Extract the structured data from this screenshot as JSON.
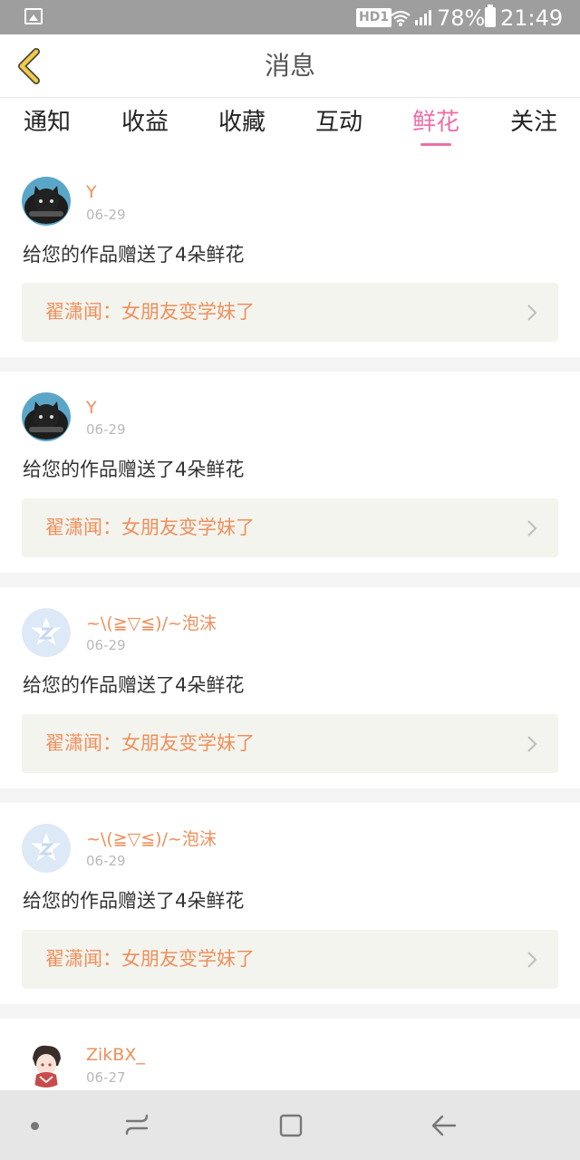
{
  "status_bar": {
    "network_badge": "HD1",
    "battery_percent": "78%",
    "time": "21:49",
    "icons": [
      "image-icon",
      "wifi-icon",
      "signal-icon",
      "battery-icon"
    ]
  },
  "header": {
    "title": "消息",
    "back_icon": "chevron-left-icon",
    "accent_color": "#f2c94c"
  },
  "tabs": [
    {
      "label": "通知",
      "active": false
    },
    {
      "label": "收益",
      "active": false
    },
    {
      "label": "收藏",
      "active": false
    },
    {
      "label": "互动",
      "active": false
    },
    {
      "label": "鲜花",
      "active": true
    },
    {
      "label": "关注",
      "active": false
    }
  ],
  "theme": {
    "active_tab_color": "#ec6fa8",
    "username_color": "#ef8f5b",
    "link_bg": "#f3f4ee"
  },
  "messages": [
    {
      "username": "Y",
      "date": "06-29",
      "text": "给您的作品赠送了4朵鲜花",
      "work": "翟潇闻：女朋友变学妹了",
      "avatar": "cat-avatar"
    },
    {
      "username": "Y",
      "date": "06-29",
      "text": "给您的作品赠送了4朵鲜花",
      "work": "翟潇闻：女朋友变学妹了",
      "avatar": "cat-avatar"
    },
    {
      "username": "~\\(≧▽≦)/~泡沫",
      "date": "06-29",
      "text": "给您的作品赠送了4朵鲜花",
      "work": "翟潇闻：女朋友变学妹了",
      "avatar": "default-avatar"
    },
    {
      "username": "~\\(≧▽≦)/~泡沫",
      "date": "06-29",
      "text": "给您的作品赠送了4朵鲜花",
      "work": "翟潇闻：女朋友变学妹了",
      "avatar": "default-avatar"
    },
    {
      "username": "ZikBX_",
      "date": "06-27",
      "avatar": "anime-avatar"
    }
  ],
  "nav_bar": {
    "icons": [
      "dot-icon",
      "recent-apps-icon",
      "home-icon",
      "back-icon"
    ]
  }
}
